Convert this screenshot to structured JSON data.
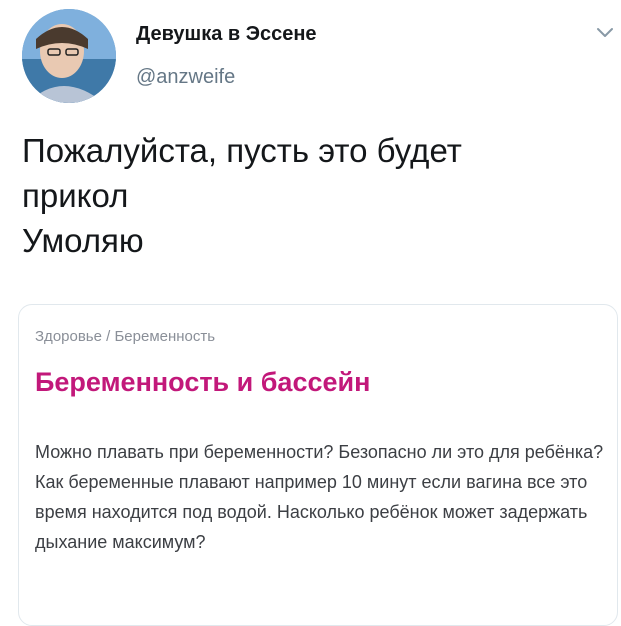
{
  "tweet": {
    "display_name": "Девушка в Эссене",
    "handle": "@anzweife",
    "text_lines": [
      "Пожалуйста, пусть это будет",
      "прикол",
      "Умоляю"
    ]
  },
  "card": {
    "breadcrumb": "Здоровье / Беременность",
    "title": "Беременность и бассейн",
    "body": "Можно плавать при беременности? Безопасно ли это для ребёнка? Как беременные плавают например 10 минут если вагина все это время находится под водой. Насколько ребёнок может задержать дыхание максимум?"
  },
  "icons": {
    "menu": "chevron-down-icon"
  },
  "colors": {
    "title_accent": "#c2187a",
    "handle": "#657786"
  }
}
